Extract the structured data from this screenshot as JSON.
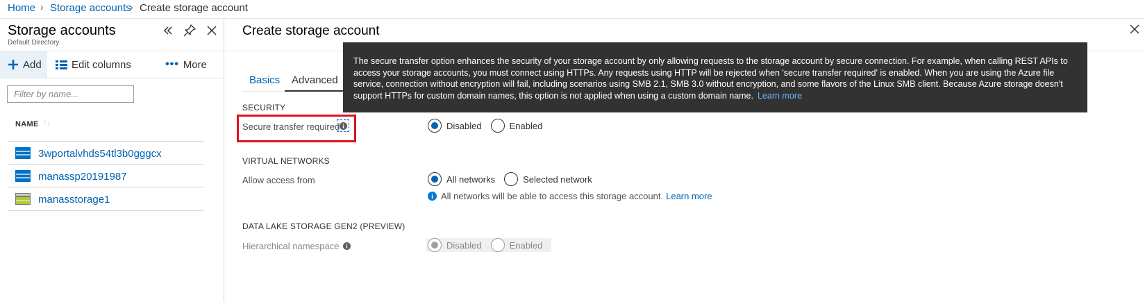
{
  "breadcrumb": {
    "items": [
      "Home",
      "Storage accounts"
    ],
    "current": "Create storage account"
  },
  "left_blade": {
    "title": "Storage accounts",
    "subtitle": "Default Directory",
    "commands": {
      "add": "Add",
      "edit_columns": "Edit columns",
      "more": "More"
    },
    "filter_placeholder": "Filter by name...",
    "column_header": "NAME",
    "accounts": [
      {
        "name": "3wportalvhds54tl3b0gggcx",
        "icon": "storage-account-blue-icon"
      },
      {
        "name": "manassp20191987",
        "icon": "storage-account-blue-icon"
      },
      {
        "name": "manasstorage1",
        "icon": "storage-account-green-icon"
      }
    ]
  },
  "main": {
    "title": "Create storage account",
    "tabs": [
      {
        "label": "Basics"
      },
      {
        "label": "Advanced"
      }
    ],
    "active_tab": "Advanced",
    "tooltip": {
      "text": "The secure transfer option enhances the security of your storage account by only allowing requests to the storage account by secure connection. For example, when calling REST APIs to access your storage accounts, you must connect using HTTPs. Any requests using HTTP will be rejected when 'secure transfer required' is enabled. When you are using the Azure file service, connection without encryption will fail, including scenarios using SMB 2.1, SMB 3.0 without encryption, and some flavors of the Linux SMB client. Because Azure storage doesn't support HTTPs for custom domain names, this option is not applied when using a custom domain name.",
      "link": "Learn more"
    },
    "security": {
      "heading": "SECURITY",
      "label": "Secure transfer required",
      "options": [
        "Disabled",
        "Enabled"
      ],
      "selected": "Disabled"
    },
    "virtual_networks": {
      "heading": "VIRTUAL NETWORKS",
      "label": "Allow access from",
      "options": [
        "All networks",
        "Selected network"
      ],
      "selected": "All networks",
      "info_text": "All networks will be able to access this storage account.",
      "info_link": "Learn more"
    },
    "data_lake": {
      "heading": "DATA LAKE STORAGE GEN2 (PREVIEW)",
      "label": "Hierarchical namespace",
      "options": [
        "Disabled",
        "Enabled"
      ],
      "selected": "Disabled",
      "disabled": true
    }
  },
  "colors": {
    "link": "#0063b1",
    "tooltip_bg": "#323232",
    "highlight": "#e2101d",
    "add_highlight": "#e8f0f8"
  }
}
